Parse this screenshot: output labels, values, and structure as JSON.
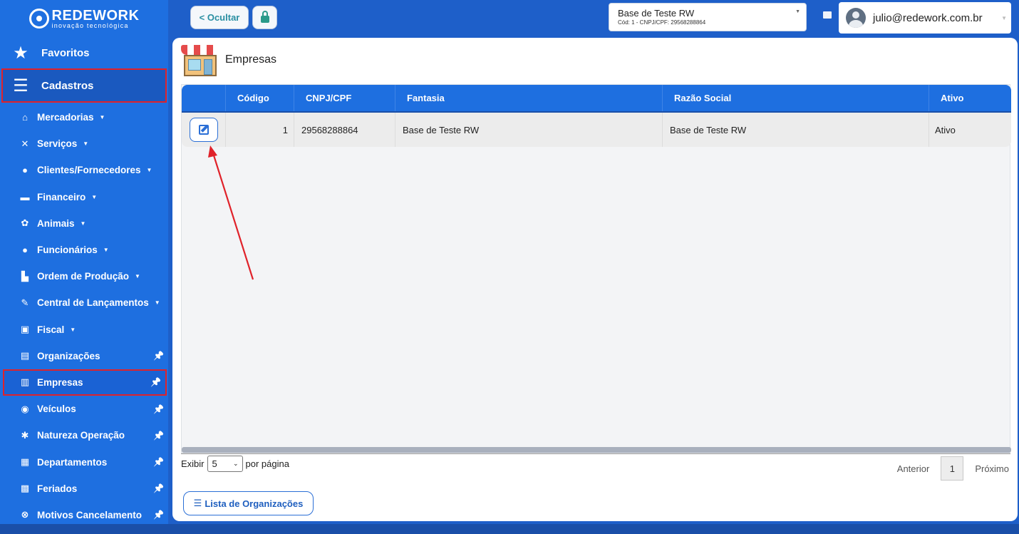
{
  "brand": {
    "name": "REDEWORK",
    "tagline": "inovação tecnológica"
  },
  "sidebar": {
    "favorites_label": "Favoritos",
    "cadastros_label": "Cadastros",
    "items": [
      {
        "label": "Mercadorias",
        "icon": "basket-icon",
        "caret": true
      },
      {
        "label": "Serviços",
        "icon": "tools-icon",
        "caret": true
      },
      {
        "label": "Clientes/Fornecedores",
        "icon": "user-icon",
        "caret": true
      },
      {
        "label": "Financeiro",
        "icon": "money-icon",
        "caret": true
      },
      {
        "label": "Animais",
        "icon": "paw-icon",
        "caret": true
      },
      {
        "label": "Funcionários",
        "icon": "user-icon",
        "caret": true
      },
      {
        "label": "Ordem de Produção",
        "icon": "factory-icon",
        "caret": true
      },
      {
        "label": "Central de Lançamentos",
        "icon": "edit-icon",
        "caret": true
      },
      {
        "label": "Fiscal",
        "icon": "briefcase-icon",
        "caret": true
      },
      {
        "label": "Organizações",
        "icon": "toolbox-icon",
        "pin": true
      },
      {
        "label": "Empresas",
        "icon": "warehouse-icon",
        "pin": true,
        "active": true
      },
      {
        "label": "Veículos",
        "icon": "car-icon",
        "pin": true
      },
      {
        "label": "Natureza Operação",
        "icon": "gears-icon",
        "pin": true
      },
      {
        "label": "Departamentos",
        "icon": "building-icon",
        "pin": true
      },
      {
        "label": "Feriados",
        "icon": "calendar-icon",
        "pin": true
      },
      {
        "label": "Motivos Cancelamento",
        "icon": "cancel-icon",
        "pin": true
      }
    ]
  },
  "topbar": {
    "hide_label": "< Ocultar",
    "base_name": "Base de Teste RW",
    "base_sub": "Cód: 1 - CNPJ/CPF: 29568288864",
    "user_email": "julio@redework.com.br"
  },
  "page": {
    "title": "Empresas",
    "columns": [
      "",
      "Código",
      "CNPJ/CPF",
      "Fantasia",
      "Razão Social",
      "Ativo"
    ],
    "rows": [
      {
        "codigo": "1",
        "cnpj": "29568288864",
        "fantasia": "Base de Teste RW",
        "razao": "Base de Teste RW",
        "ativo": "Ativo"
      }
    ],
    "pager": {
      "show_label": "Exibir",
      "per_page_value": "5",
      "per_page_suffix": "por página",
      "prev_label": "Anterior",
      "current_page": "1",
      "next_label": "Próximo"
    },
    "list_button_label": "Lista de Organizações"
  },
  "colors": {
    "sidebar": "#1e6fe0",
    "highlight": "#e0222a",
    "accent": "#2b6fd6"
  }
}
